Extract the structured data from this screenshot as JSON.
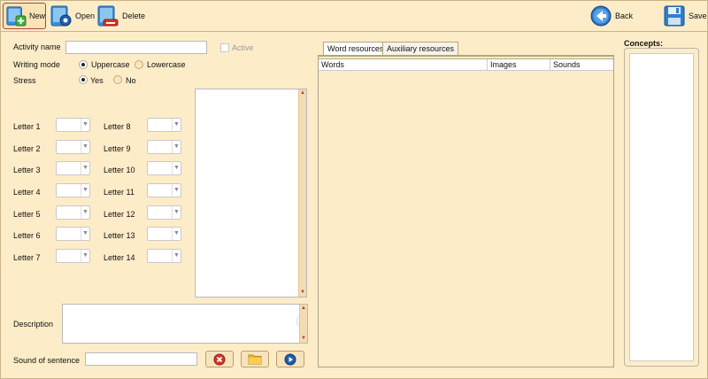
{
  "toolbar": {
    "new_label": "New",
    "open_label": "Open",
    "delete_label": "Delete",
    "back_label": "Back",
    "save_label": "Save"
  },
  "form": {
    "activity_name_label": "Activity name",
    "activity_name_value": "",
    "active_label": "Active",
    "active_checked": false,
    "writing_mode_label": "Writing mode",
    "uppercase_label": "Uppercase",
    "lowercase_label": "Lowercase",
    "writing_mode_selected": "Uppercase",
    "stress_label": "Stress",
    "yes_label": "Yes",
    "no_label": "No",
    "stress_selected": "Yes",
    "letters_left": [
      "Letter 1",
      "Letter 2",
      "Letter 3",
      "Letter 4",
      "Letter 5",
      "Letter 6",
      "Letter 7"
    ],
    "letters_right": [
      "Letter 8",
      "Letter 9",
      "Letter 10",
      "Letter 11",
      "Letter 12",
      "Letter 13",
      "Letter 14"
    ],
    "description_label": "Description",
    "description_value": "",
    "sound_label": "Sound of sentence",
    "sound_value": ""
  },
  "tabs": [
    "Word resources",
    "Auxiliary resources"
  ],
  "active_tab": "Word resources",
  "grid": {
    "columns": [
      "Words",
      "Images",
      "Sounds"
    ],
    "rows": []
  },
  "concepts": {
    "title": "Concepts:",
    "items": []
  },
  "colors": {
    "background": "#fdecc8",
    "grid_header": "#ffffff",
    "accent_red": "#c0392b",
    "accent_blue": "#1f5fa8"
  }
}
